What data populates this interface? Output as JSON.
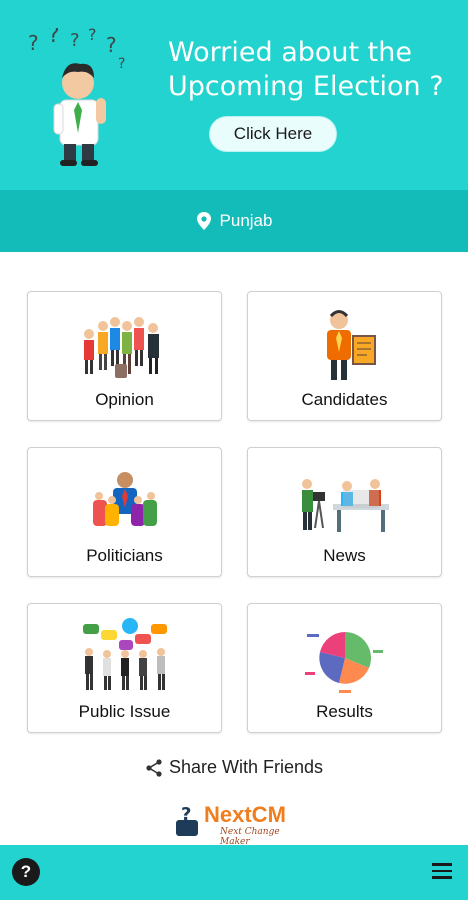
{
  "hero": {
    "title": "Worried about the Upcoming Election ?",
    "cta_label": "Click Here",
    "bg_color": "#22d3cf"
  },
  "location": {
    "icon": "map-pin-icon",
    "label": "Punjab"
  },
  "menu": [
    {
      "label": "Opinion",
      "icon": "crowd-icon"
    },
    {
      "label": "Candidates",
      "icon": "candidate-icon"
    },
    {
      "label": "Politicians",
      "icon": "politician-icon"
    },
    {
      "label": "News",
      "icon": "news-icon"
    },
    {
      "label": "Public Issue",
      "icon": "protest-icon"
    },
    {
      "label": "Results",
      "icon": "pie-chart-icon"
    }
  ],
  "share": {
    "icon": "share-icon",
    "label": "Share With Friends"
  },
  "brand": {
    "name": "NextCM",
    "tagline": "Next Change Maker",
    "color": "#f07e1d"
  },
  "bottom_bar": {
    "help_icon": "help-icon",
    "menu_icon": "hamburger-menu-icon"
  }
}
